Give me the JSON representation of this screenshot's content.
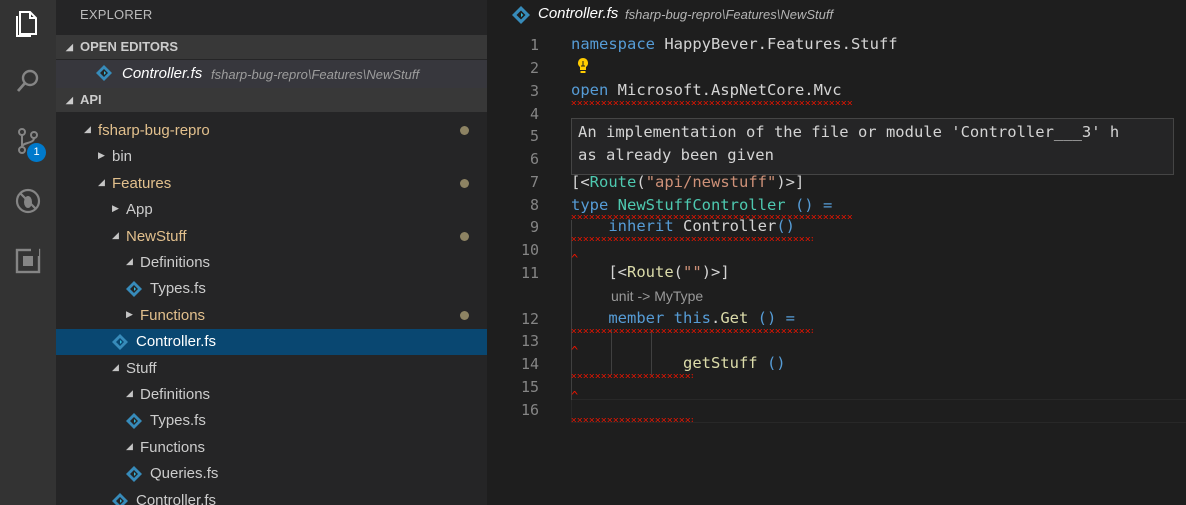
{
  "sidebar": {
    "title": "EXPLORER",
    "open_editors_label": "OPEN EDITORS",
    "open_editor": {
      "name": "Controller.fs",
      "path": "fsharp-bug-repro\\Features\\NewStuff"
    },
    "workspace_label": "API",
    "tree": [
      {
        "label": "fsharp-bug-repro",
        "state": "expanded",
        "icon": "",
        "modified": true
      },
      {
        "label": "bin",
        "state": "collapsed",
        "icon": "",
        "modified": false
      },
      {
        "label": "Features",
        "state": "expanded",
        "icon": "",
        "modified": true
      },
      {
        "label": "App",
        "state": "collapsed",
        "icon": "",
        "modified": false
      },
      {
        "label": "NewStuff",
        "state": "expanded",
        "icon": "",
        "modified": true
      },
      {
        "label": "Definitions",
        "state": "expanded",
        "icon": "",
        "modified": false
      },
      {
        "label": "Types.fs",
        "state": "",
        "icon": "fsharp-file-icon",
        "modified": false
      },
      {
        "label": "Functions",
        "state": "collapsed",
        "icon": "",
        "modified": true
      },
      {
        "label": "Controller.fs",
        "state": "",
        "icon": "fsharp-file-icon",
        "modified": false,
        "selected": true
      },
      {
        "label": "Stuff",
        "state": "expanded",
        "icon": "",
        "modified": false
      },
      {
        "label": "Definitions",
        "state": "expanded",
        "icon": "",
        "modified": false
      },
      {
        "label": "Types.fs",
        "state": "",
        "icon": "fsharp-file-icon",
        "modified": false
      },
      {
        "label": "Functions",
        "state": "expanded",
        "icon": "",
        "modified": false
      },
      {
        "label": "Queries.fs",
        "state": "",
        "icon": "fsharp-file-icon",
        "modified": false
      },
      {
        "label": "Controller.fs",
        "state": "",
        "icon": "fsharp-file-icon",
        "modified": false
      }
    ]
  },
  "activity_bar": {
    "items": [
      "explorer-icon",
      "search-icon",
      "source-control-icon",
      "debug-icon",
      "extensions-icon"
    ],
    "source_control_badge": "1"
  },
  "editor": {
    "breadcrumb": {
      "file": "Controller.fs",
      "path": "fsharp-bug-repro\\Features\\NewStuff"
    },
    "line_numbers": [
      "1",
      "2",
      "3",
      "4",
      "5",
      "6",
      "7",
      "8",
      "9",
      "10",
      "11",
      "12",
      "13",
      "14",
      "15",
      "16"
    ],
    "code": {
      "l1_kw": "namespace",
      "l1_rest": " HappyBever.Features.Stuff",
      "l3_kw": "open",
      "l3_rest": " Microsoft.AspNetCore.Mvc",
      "l7_a": "[<",
      "l7_b": "Route",
      "l7_c": "(",
      "l7_d": "\"api/newstuff\"",
      "l7_e": ")>]",
      "l8_kw": "type",
      "l8_name": " NewStuffController",
      "l8_rest": " () =",
      "l9_kw": "inherit",
      "l9_name": " Controller",
      "l9_rest": "()",
      "l11_a": "[<",
      "l11_b": "Route",
      "l11_c": "(",
      "l11_d": "\"\"",
      "l11_e": ")>]",
      "l12_kw": "member",
      "l12_this": " this",
      "l12_dot": ".",
      "l12_get": "Get",
      "l12_rest": " () =",
      "l14_fn": "getStuff",
      "l14_rest": " ()"
    },
    "codelens": "unit -> MyType",
    "hover": {
      "line1": "An implementation of the file or module 'Controller___3' h",
      "line2": "as already been given"
    },
    "error_marker": "^"
  }
}
